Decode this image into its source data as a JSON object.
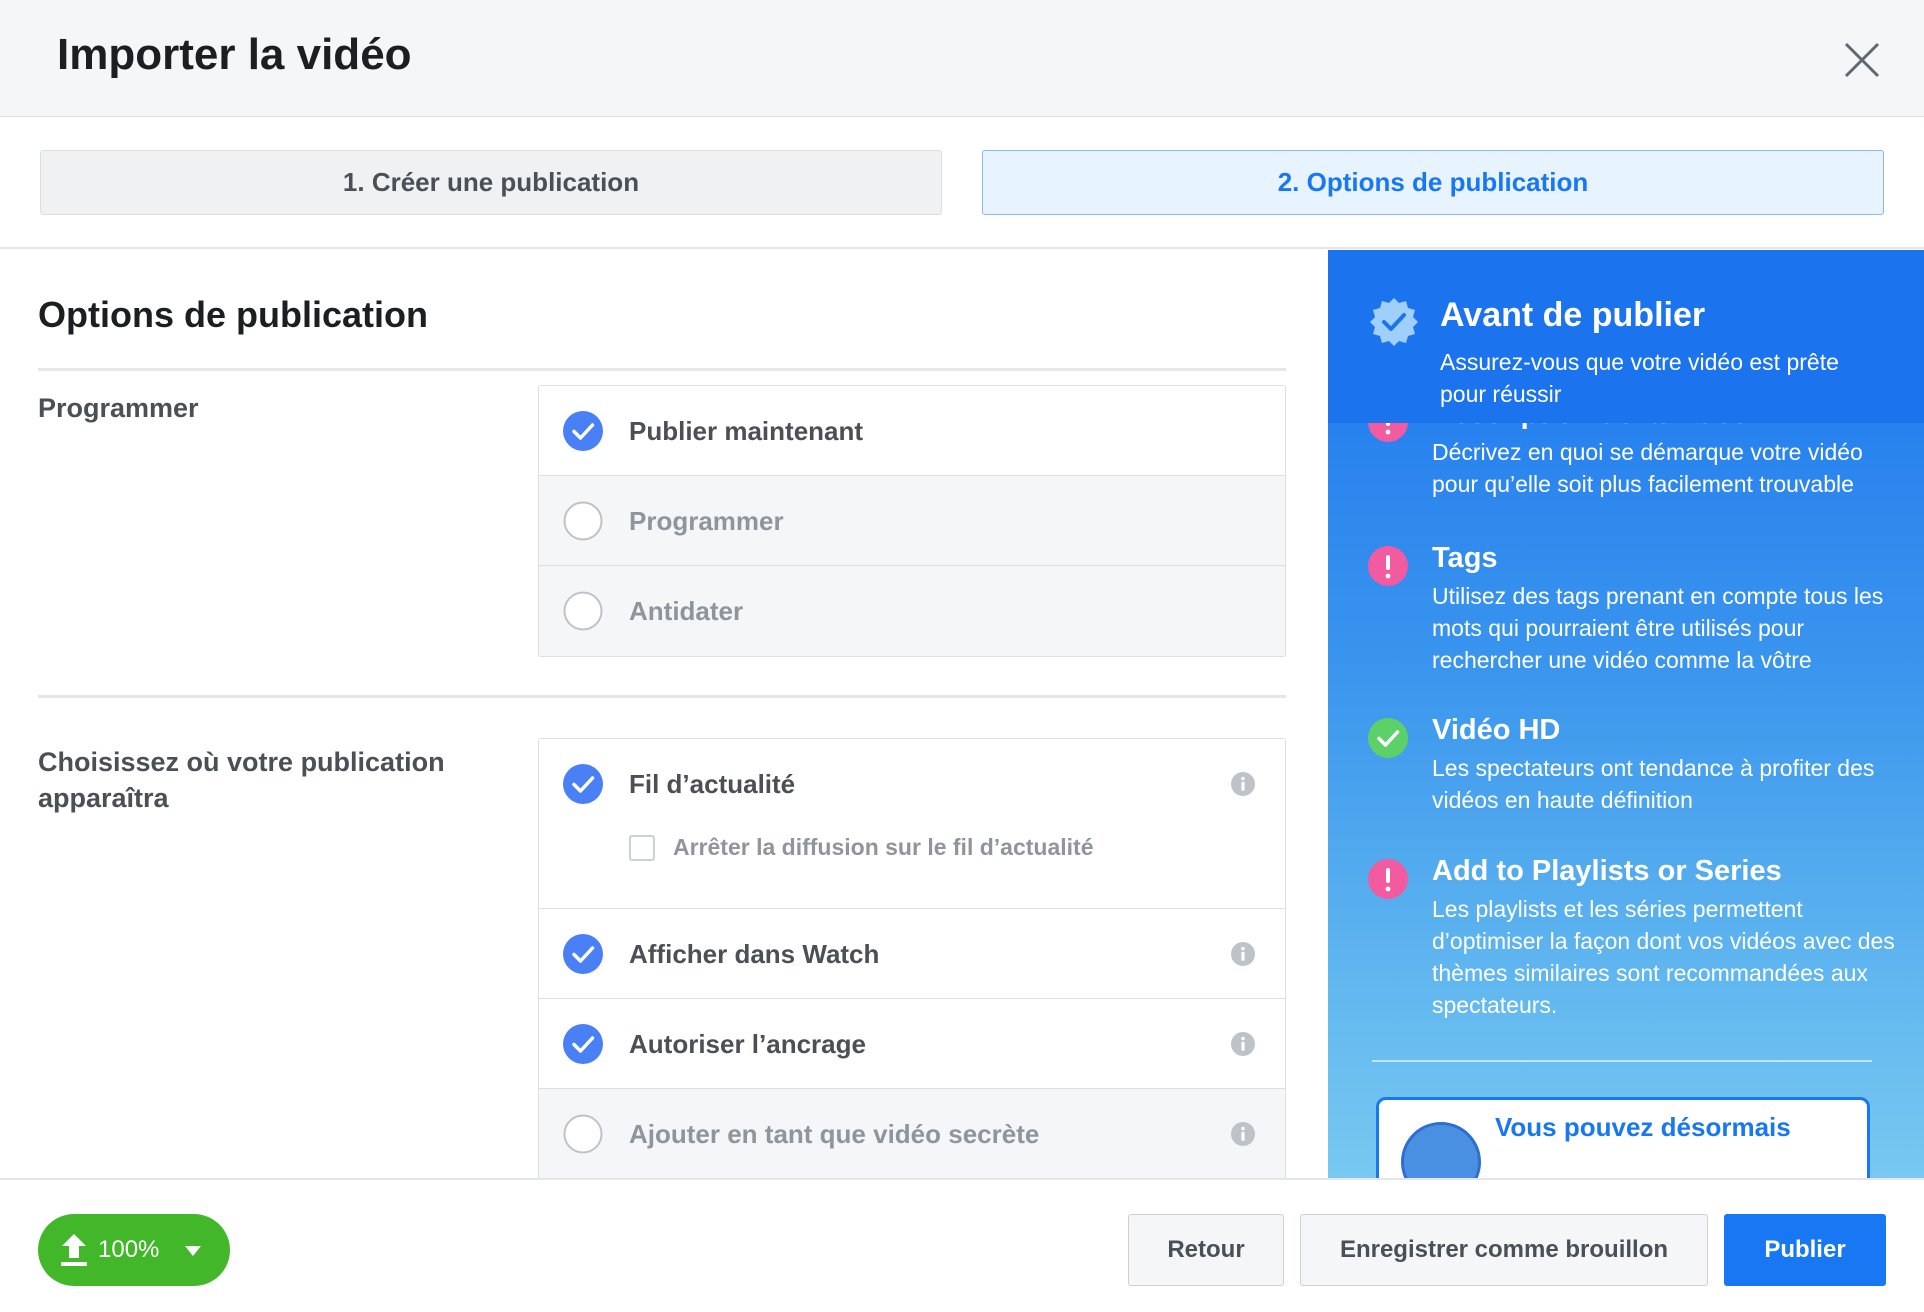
{
  "header": {
    "title": "Importer la vidéo"
  },
  "steps": [
    {
      "label": "1. Créer une publication",
      "active": false
    },
    {
      "label": "2. Options de publication",
      "active": true
    }
  ],
  "main": {
    "title": "Options de publication",
    "schedule": {
      "label": "Programmer",
      "options": [
        {
          "label": "Publier maintenant",
          "selected": true
        },
        {
          "label": "Programmer",
          "selected": false
        },
        {
          "label": "Antidater",
          "selected": false
        }
      ]
    },
    "placement": {
      "label": "Choisissez où votre publication apparaîtra",
      "options": [
        {
          "label": "Fil d’actualité",
          "checked": true,
          "sub_label": "Arrêter la diffusion sur le fil d’actualité"
        },
        {
          "label": "Afficher dans Watch",
          "checked": true
        },
        {
          "label": "Autoriser l’ancrage",
          "checked": true
        },
        {
          "label": "Ajouter en tant que vidéo secrète",
          "checked": false
        }
      ]
    }
  },
  "sidebar": {
    "title": "Avant de publier",
    "subtitle": "Assurez-vous que votre vidéo est prête pour réussir",
    "tips": [
      {
        "title": "Description de la vidéo",
        "desc": "Décrivez en quoi se démarque votre vidéo pour qu’elle soit plus facilement trouvable",
        "status": "warning"
      },
      {
        "title": "Tags",
        "desc": "Utilisez des tags prenant en compte tous les mots qui pourraient être utilisés pour rechercher une vidéo comme la vôtre",
        "status": "warning"
      },
      {
        "title": "Vidéo HD",
        "desc": "Les spectateurs ont tendance à profiter des vidéos en haute définition",
        "status": "ok"
      },
      {
        "title": "Add to Playlists or Series",
        "desc": "Les playlists et les séries permettent d’optimiser la façon dont vos vidéos avec des thèmes similaires sont recommandées aux spectateurs.",
        "status": "warning"
      }
    ],
    "promo_text": "Vous pouvez désormais"
  },
  "footer": {
    "upload_progress": "100%",
    "back_label": "Retour",
    "draft_label": "Enregistrer comme brouillon",
    "publish_label": "Publier"
  },
  "colors": {
    "accent": "#1877f2",
    "success": "#42b72a",
    "warning": "#f35ba0",
    "checkbox_blue": "#4a80f5"
  }
}
